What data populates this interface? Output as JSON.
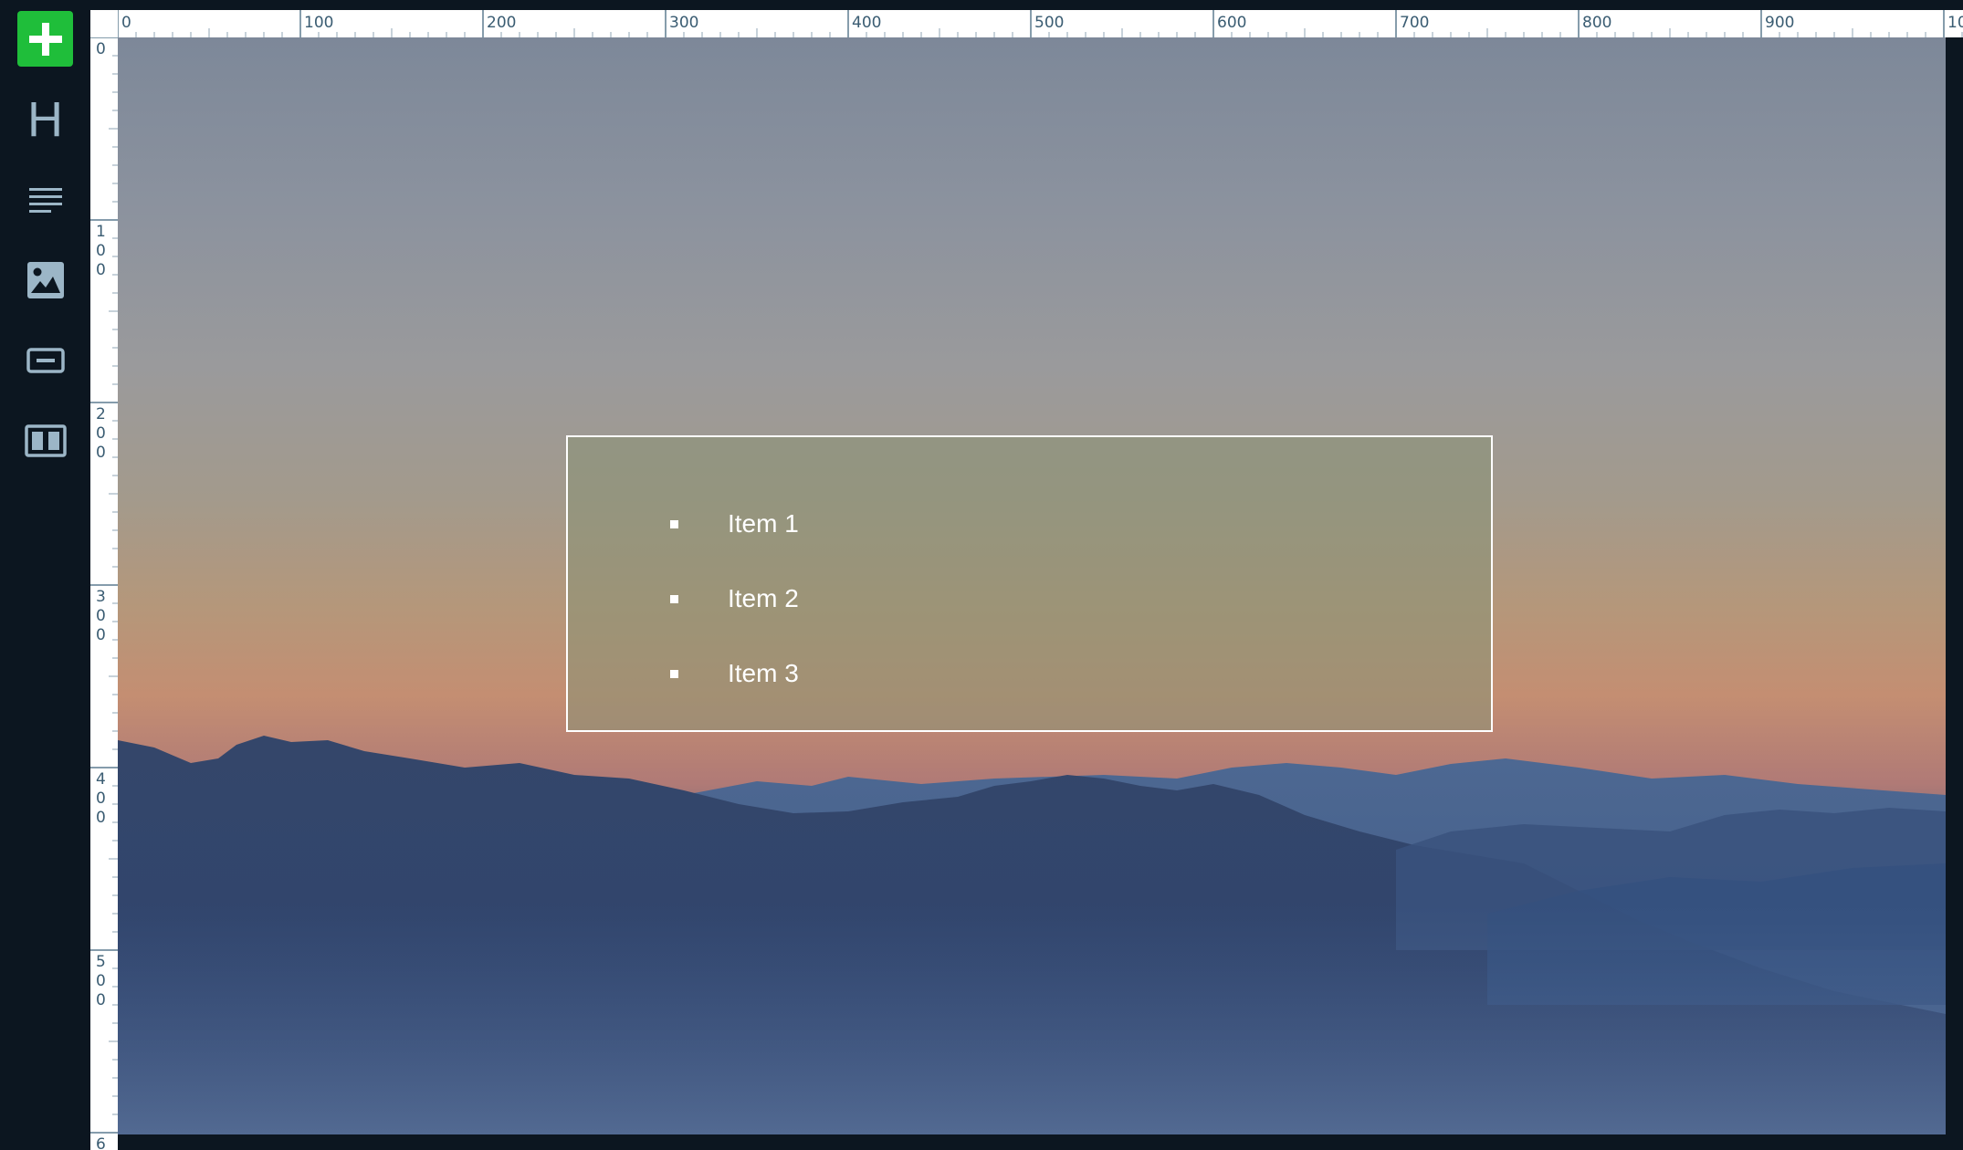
{
  "toolbar": {
    "tools": [
      {
        "name": "add",
        "icon": "plus-icon",
        "color": "#1fbe3a"
      },
      {
        "name": "heading",
        "icon": "heading-icon",
        "glyph": "H"
      },
      {
        "name": "text",
        "icon": "text-lines-icon"
      },
      {
        "name": "image",
        "icon": "image-icon"
      },
      {
        "name": "button",
        "icon": "button-icon"
      },
      {
        "name": "columns",
        "icon": "columns-icon"
      }
    ]
  },
  "ruler": {
    "top_labels": [
      "0",
      "100",
      "200",
      "300",
      "400",
      "500",
      "600",
      "700",
      "800",
      "900",
      "10"
    ],
    "left_labels": [
      [
        "0"
      ],
      [
        "1",
        "0",
        "0"
      ],
      [
        "2",
        "0",
        "0"
      ],
      [
        "3",
        "0",
        "0"
      ],
      [
        "4",
        "0",
        "0"
      ],
      [
        "5",
        "0",
        "0"
      ],
      [
        "6"
      ]
    ]
  },
  "canvas": {
    "background": "mountain-sunset-image",
    "list_block": {
      "items": [
        "Item 1",
        "Item 2",
        "Item 3"
      ]
    }
  },
  "colors": {
    "toolbar_bg": "#0c1620",
    "accent_green": "#1fbe3a",
    "icon": "#9cb6c7",
    "ruler_text": "#3a5c72"
  }
}
